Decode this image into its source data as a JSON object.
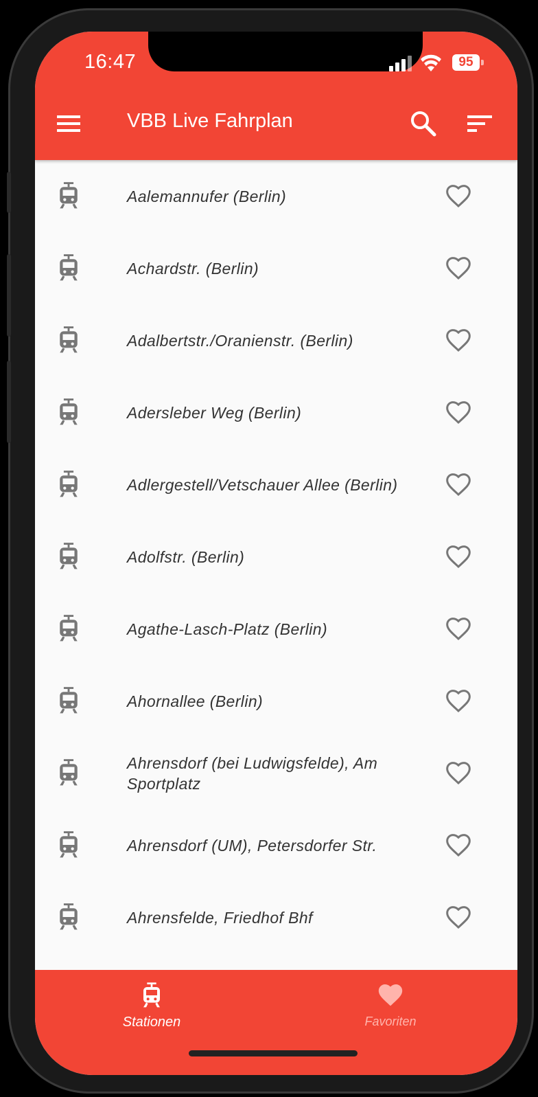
{
  "status_bar": {
    "time": "16:47",
    "battery": "95"
  },
  "app_bar": {
    "title": "VBB Live Fahrplan"
  },
  "stations": [
    {
      "name": "Aalemannufer (Berlin)"
    },
    {
      "name": "Achardstr. (Berlin)"
    },
    {
      "name": "Adalbertstr./Oranienstr. (Berlin)"
    },
    {
      "name": "Adersleber Weg (Berlin)"
    },
    {
      "name": "Adlergestell/Vetschauer Allee (Berlin)"
    },
    {
      "name": "Adolfstr. (Berlin)"
    },
    {
      "name": "Agathe-Lasch-Platz (Berlin)"
    },
    {
      "name": "Ahornallee (Berlin)"
    },
    {
      "name": "Ahrensdorf (bei Ludwigsfelde), Am Sportplatz"
    },
    {
      "name": "Ahrensdorf (UM), Petersdorfer Str."
    },
    {
      "name": "Ahrensfelde, Friedhof Bhf"
    }
  ],
  "bottom_nav": {
    "stations_label": "Stationen",
    "favorites_label": "Favoriten"
  },
  "colors": {
    "accent": "#f24535",
    "list_bg": "#fafafa",
    "icon": "#777777"
  },
  "icons": [
    "menu-icon",
    "search-icon",
    "sort-icon",
    "tram-icon",
    "heart-outline-icon",
    "heart-filled-icon"
  ]
}
